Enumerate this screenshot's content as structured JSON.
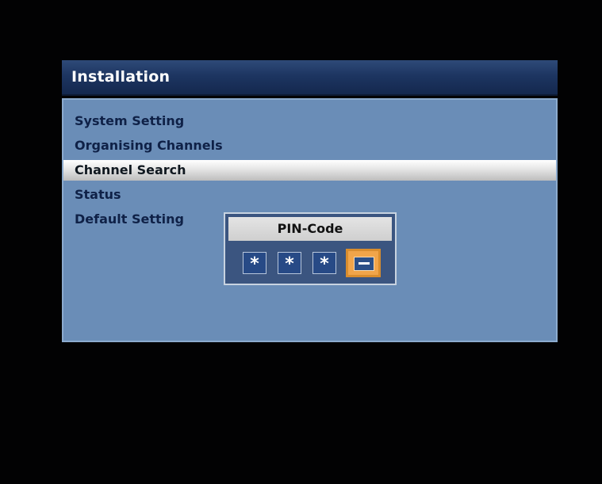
{
  "header": {
    "title": "Installation"
  },
  "menu": {
    "items": [
      {
        "label": "System Setting"
      },
      {
        "label": "Organising Channels"
      },
      {
        "label": "Channel Search",
        "selected": true
      },
      {
        "label": "Status"
      },
      {
        "label": "Default Setting"
      }
    ]
  },
  "pin_dialog": {
    "title": "PIN-Code",
    "digits": [
      "*",
      "*",
      "*",
      "-"
    ]
  },
  "colors": {
    "header_bg": "#1d3561",
    "panel_bg": "#6a8db7",
    "selected_bg": "#e8e8e8",
    "active_digit": "#f1a54a"
  }
}
